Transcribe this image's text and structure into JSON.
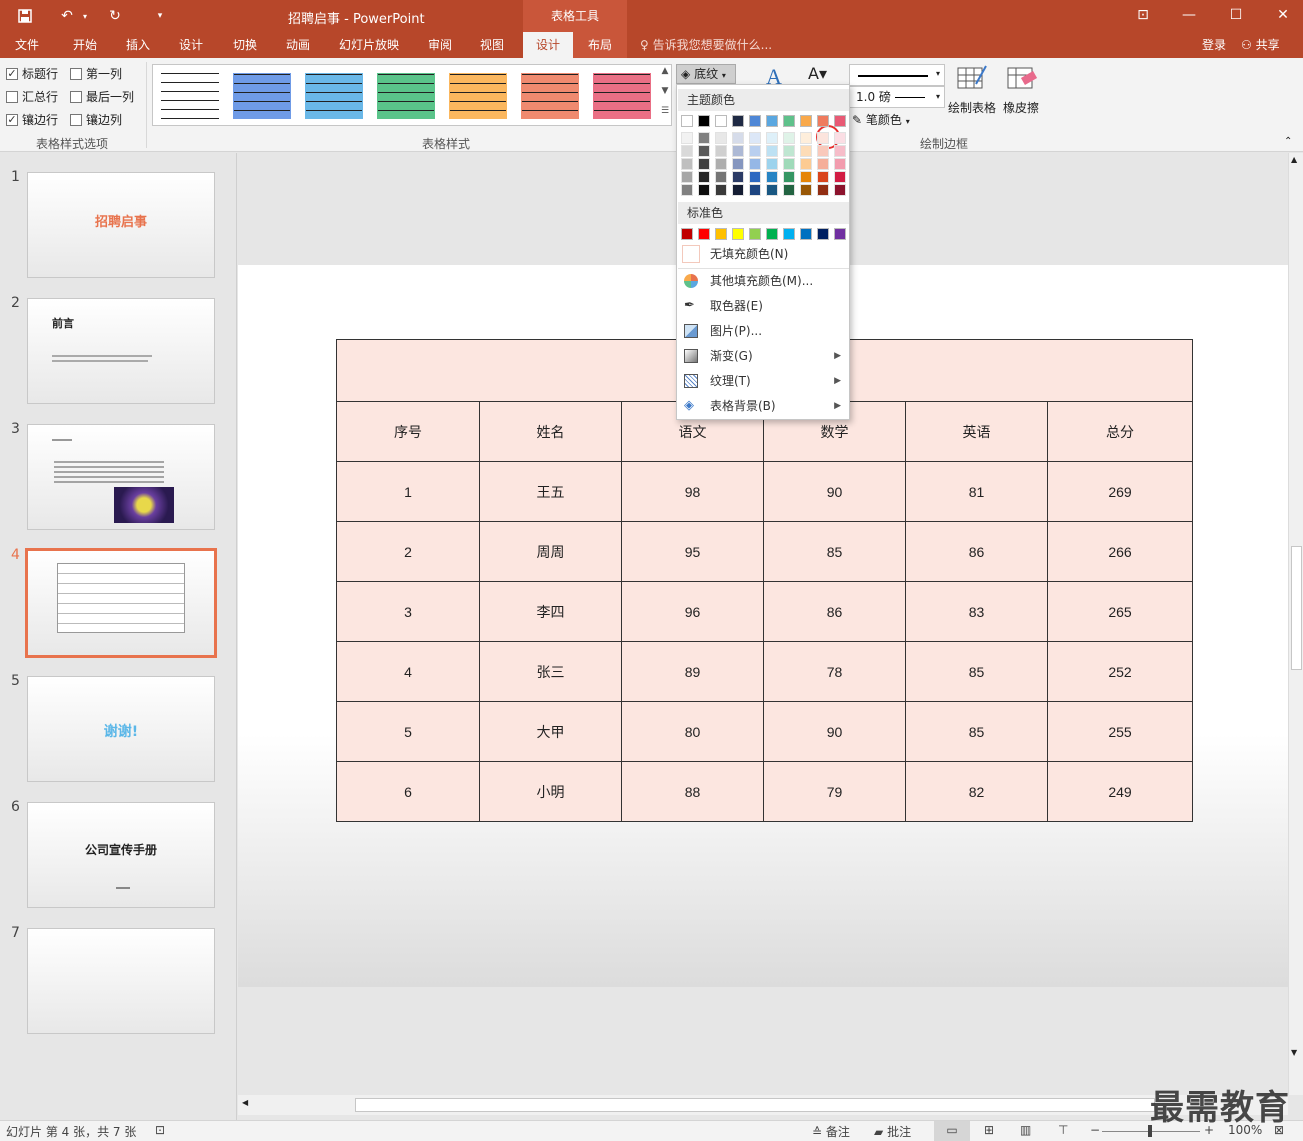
{
  "window": {
    "title": "招聘启事 - PowerPoint",
    "context_tab_group": "表格工具"
  },
  "tabs": [
    "文件",
    "开始",
    "插入",
    "设计",
    "切换",
    "动画",
    "幻灯片放映",
    "审阅",
    "视图",
    "设计",
    "布局"
  ],
  "tell_me": "告诉我您想要做什么...",
  "account": {
    "login": "登录",
    "share": "共享"
  },
  "ribbon": {
    "options": {
      "header_row": "标题行",
      "first_column": "第一列",
      "total_row": "汇总行",
      "last_column": "最后一列",
      "banded_rows": "镶边行",
      "banded_columns": "镶边列",
      "group_label": "表格样式选项",
      "checked": {
        "header_row": true,
        "first_column": false,
        "total_row": false,
        "last_column": false,
        "banded_rows": true,
        "banded_columns": false
      }
    },
    "styles": {
      "group_label": "表格样式",
      "thumb_colors": [
        "#ffffff",
        "#6f9be7",
        "#6ab8e8",
        "#5ac48a",
        "#fbb75e",
        "#f08a6f",
        "#ea6f85"
      ]
    },
    "shading": "底纹",
    "pen_weight": "1.0 磅",
    "pen_color": "笔颜色",
    "draw_table": "绘制表格",
    "eraser": "橡皮擦",
    "draw_border_group": "绘制边框"
  },
  "shading_menu": {
    "theme_colors_label": "主题颜色",
    "standard_colors_label": "标准色",
    "theme_top": [
      "#ffffff",
      "#000000",
      "#ffffff",
      "#1f2a44",
      "#4f87d6",
      "#5aa7e0",
      "#5fc18b",
      "#f9a94b",
      "#ef7b5e",
      "#e85a75"
    ],
    "theme_columns": [
      [
        "#f2f2f2",
        "#d9d9d9",
        "#bfbfbf",
        "#a6a6a6",
        "#808080"
      ],
      [
        "#808080",
        "#595959",
        "#404040",
        "#262626",
        "#0d0d0d"
      ],
      [
        "#e8e8e8",
        "#d0d0d0",
        "#aeaeae",
        "#757575",
        "#3a3a3a"
      ],
      [
        "#d6dcea",
        "#adb9d5",
        "#8596bf",
        "#2b3b66",
        "#151d33"
      ],
      [
        "#dce7f7",
        "#b9cfef",
        "#95b7e6",
        "#2c68c1",
        "#1d4581"
      ],
      [
        "#def0f9",
        "#bde1f3",
        "#9cd3ed",
        "#2784c4",
        "#1a5883"
      ],
      [
        "#dff3e8",
        "#bfe6d1",
        "#9fdab9",
        "#359663",
        "#236442"
      ],
      [
        "#feeedb",
        "#fddcb7",
        "#fccb93",
        "#e58509",
        "#995806"
      ],
      [
        "#fce4dd",
        "#f9c9bb",
        "#f5ae99",
        "#d9451d",
        "#912e13"
      ],
      [
        "#fbdee4",
        "#f6bdc9",
        "#f29cae",
        "#d21d44",
        "#8c132d"
      ]
    ],
    "standard": [
      "#c00000",
      "#ff0000",
      "#ffc000",
      "#ffff00",
      "#92d050",
      "#00b050",
      "#00b0f0",
      "#0070c0",
      "#002060",
      "#7030a0"
    ],
    "no_fill": "无填充颜色(N)",
    "more_colors": "其他填充颜色(M)...",
    "eyedropper": "取色器(E)",
    "picture": "图片(P)...",
    "gradient": "渐变(G)",
    "texture": "纹理(T)",
    "table_background": "表格背景(B)"
  },
  "slides": [
    {
      "num": "1",
      "title": "招聘启事"
    },
    {
      "num": "2",
      "title": "前言"
    },
    {
      "num": "3",
      "title": ""
    },
    {
      "num": "4",
      "title": ""
    },
    {
      "num": "5",
      "title": "谢谢!"
    },
    {
      "num": "6",
      "title": "公司宣传手册"
    },
    {
      "num": "7",
      "title": ""
    }
  ],
  "table": {
    "headers": [
      "序号",
      "姓名",
      "语文",
      "数学",
      "英语",
      "总分"
    ],
    "rows": [
      [
        "1",
        "王五",
        "98",
        "90",
        "81",
        "269"
      ],
      [
        "2",
        "周周",
        "95",
        "85",
        "86",
        "266"
      ],
      [
        "3",
        "李四",
        "96",
        "86",
        "83",
        "265"
      ],
      [
        "4",
        "张三",
        "89",
        "78",
        "85",
        "252"
      ],
      [
        "5",
        "大甲",
        "80",
        "90",
        "85",
        "255"
      ],
      [
        "6",
        "小明",
        "88",
        "79",
        "82",
        "249"
      ]
    ]
  },
  "status": {
    "slide_info": "幻灯片 第 4 张，共 7 张",
    "notes": "备注",
    "comments": "批注",
    "zoom": "100%"
  },
  "watermark": "最需教育"
}
